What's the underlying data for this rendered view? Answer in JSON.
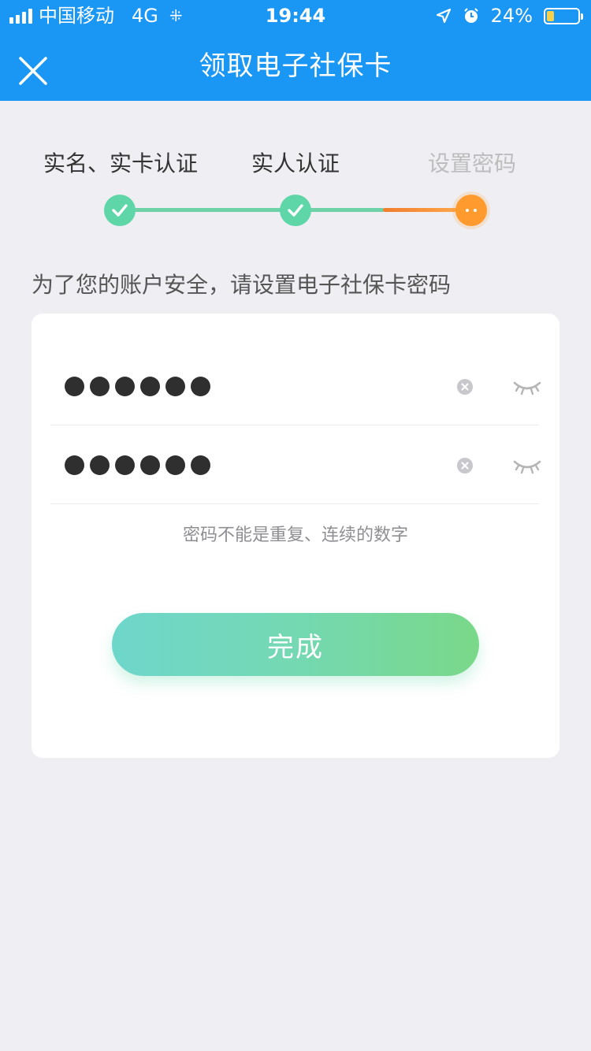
{
  "status_bar": {
    "carrier": "中国移动",
    "network": "4G",
    "time": "19:44",
    "battery_percent": "24%",
    "battery_level": 0.24,
    "icons": [
      "signal-icon",
      "loading-icon",
      "location-icon",
      "alarm-icon",
      "battery-icon"
    ]
  },
  "nav": {
    "title": "领取电子社保卡",
    "close_icon": "close-icon"
  },
  "steps": {
    "items": [
      {
        "label": "实名、实卡认证",
        "status": "done"
      },
      {
        "label": "实人认证",
        "status": "done"
      },
      {
        "label": "设置密码",
        "status": "current"
      }
    ]
  },
  "form": {
    "intro": "为了您的账户安全，请设置电子社保卡密码",
    "password_length": 6,
    "confirm_length": 6,
    "hint": "密码不能是重复、连续的数字",
    "submit_label": "完成"
  },
  "colors": {
    "header": "#1a96f5",
    "step_done": "#5ed6a8",
    "step_current": "#ff9a2e",
    "button_start": "#6fd6cb",
    "button_end": "#7ad889"
  }
}
